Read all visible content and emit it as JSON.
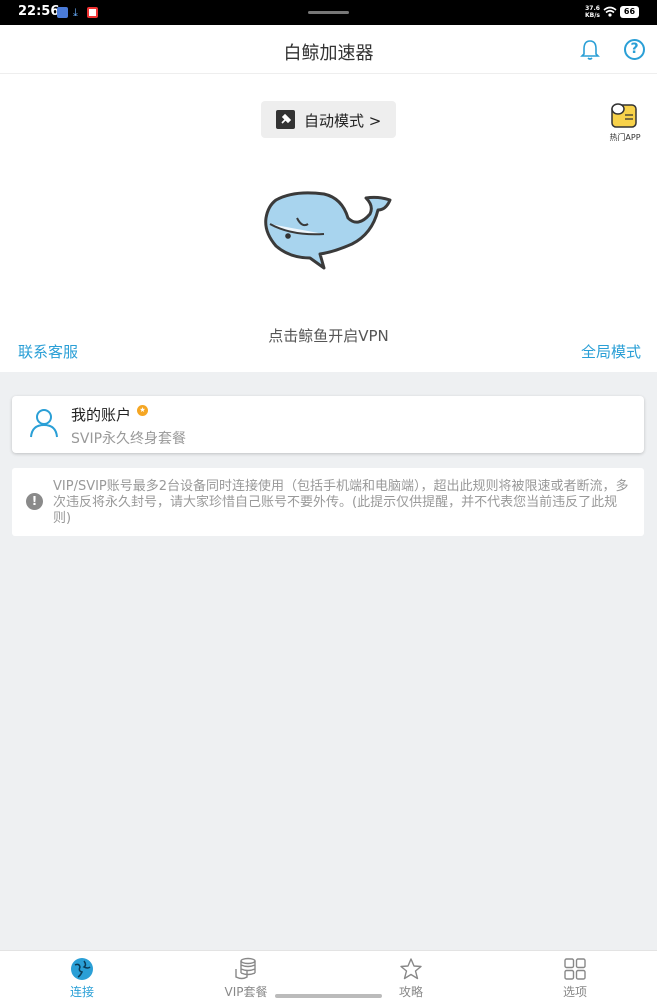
{
  "status_bar": {
    "time": "22:56",
    "speed_value": "37.6",
    "speed_unit": "KB/s",
    "battery": "66"
  },
  "header": {
    "title": "白鲸加速器"
  },
  "mode_button": {
    "label": "自动模式 >"
  },
  "hot_app": {
    "label": "热门APP"
  },
  "main": {
    "hint": "点击鲸鱼开启VPN",
    "contact_label": "联系客服",
    "global_mode_label": "全局模式"
  },
  "account": {
    "title": "我的账户",
    "plan": "SVIP永久终身套餐"
  },
  "notice": {
    "text": "VIP/SVIP账号最多2台设备同时连接使用（包括手机端和电脑端），超出此规则将被限速或者断流，多次违反将永久封号，请大家珍惜自己账号不要外传。(此提示仅供提醒，并不代表您当前违反了此规则)"
  },
  "tabs": [
    {
      "label": "连接",
      "icon": "globe-icon",
      "active": true
    },
    {
      "label": "VIP套餐",
      "icon": "coins-icon",
      "active": false
    },
    {
      "label": "攻略",
      "icon": "star-icon",
      "active": false
    },
    {
      "label": "选项",
      "icon": "grid-icon",
      "active": false
    }
  ],
  "colors": {
    "accent": "#2a9fd6",
    "whale": "#a8d4ee",
    "background": "#eef0f2"
  }
}
